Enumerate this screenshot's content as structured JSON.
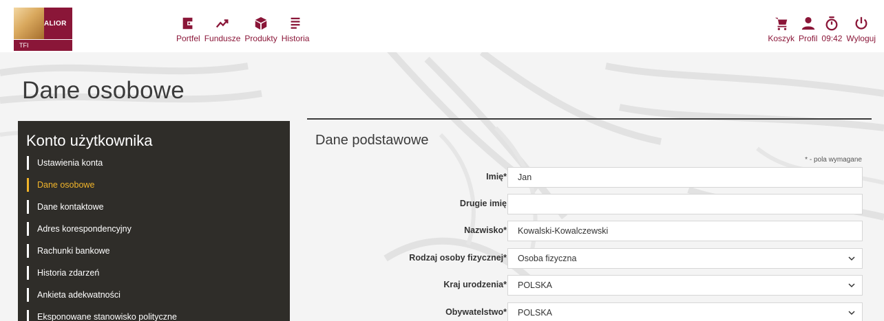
{
  "header": {
    "logo": {
      "brand": "ALIOR",
      "sub": "TFI"
    },
    "nav_left": [
      {
        "label": "Portfel",
        "icon": "wallet-icon"
      },
      {
        "label": "Fundusze",
        "icon": "trend-up-icon"
      },
      {
        "label": "Produkty",
        "icon": "box-icon"
      },
      {
        "label": "Historia",
        "icon": "list-icon"
      }
    ],
    "nav_right": [
      {
        "label": "Koszyk",
        "icon": "cart-icon"
      },
      {
        "label": "Profil",
        "icon": "user-icon"
      },
      {
        "label": "09:42",
        "icon": "timer-icon"
      },
      {
        "label": "Wyloguj",
        "icon": "power-icon"
      }
    ]
  },
  "page": {
    "title": "Dane osobowe"
  },
  "sidebar": {
    "title": "Konto użytkownika",
    "items": [
      {
        "label": "Ustawienia konta",
        "active": false
      },
      {
        "label": "Dane osobowe",
        "active": true
      },
      {
        "label": "Dane kontaktowe",
        "active": false
      },
      {
        "label": "Adres korespondencyjny",
        "active": false
      },
      {
        "label": "Rachunki bankowe",
        "active": false
      },
      {
        "label": "Historia zdarzeń",
        "active": false
      },
      {
        "label": "Ankieta adekwatności",
        "active": false
      },
      {
        "label": "Eksponowane stanowisko polityczne",
        "active": false
      }
    ]
  },
  "form": {
    "title": "Dane podstawowe",
    "required_note": "* - pola wymagane",
    "fields": [
      {
        "label": "Imię*",
        "value": "Jan",
        "type": "text"
      },
      {
        "label": "Drugie imię",
        "value": "",
        "type": "text"
      },
      {
        "label": "Nazwisko*",
        "value": "Kowalski-Kowalczewski",
        "type": "text"
      },
      {
        "label": "Rodzaj osoby fizycznej*",
        "value": "Osoba fizyczna",
        "type": "select"
      },
      {
        "label": "Kraj urodzenia*",
        "value": "POLSKA",
        "type": "select"
      },
      {
        "label": "Obywatelstwo*",
        "value": "POLSKA",
        "type": "select"
      }
    ]
  },
  "colors": {
    "brand": "#8a1638",
    "sidebar_bg": "#2f2d29",
    "active": "#f2b52a"
  }
}
